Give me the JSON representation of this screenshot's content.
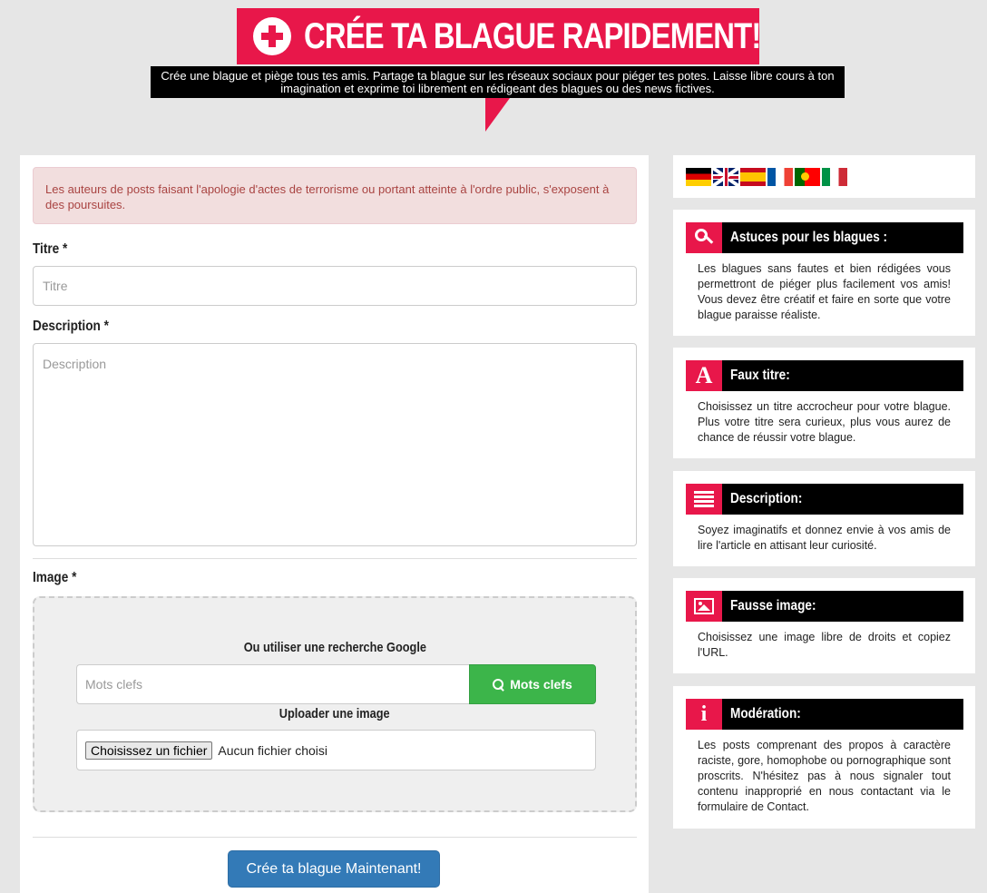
{
  "header": {
    "title": "CRÉE TA BLAGUE RAPIDEMENT!",
    "subtitle": "Crée une blague et piège tous tes amis. Partage ta blague sur les réseaux sociaux pour piéger tes potes. Laisse libre cours à ton imagination et exprime toi librement en rédigeant des blagues ou des news fictives.",
    "icon": "plus-circle-icon"
  },
  "form": {
    "alert": "Les auteurs de posts faisant l'apologie d'actes de terrorisme ou portant atteinte à l'ordre public, s'exposent à des poursuites.",
    "title_label": "Titre *",
    "title_placeholder": "Titre",
    "description_label": "Description *",
    "description_placeholder": "Description",
    "image_label": "Image *",
    "google_heading": "Ou utiliser une recherche Google",
    "keywords_placeholder": "Mots clefs",
    "keywords_button": "Mots clefs",
    "upload_heading": "Uploader une image",
    "file_button": "Choisissez un fichier",
    "file_status": "Aucun fichier choisi",
    "submit": "Crée ta blague Maintenant!"
  },
  "flags": [
    "de",
    "en",
    "es",
    "fr",
    "pt",
    "it"
  ],
  "tips": [
    {
      "icon": "key-icon",
      "title": "Astuces pour les blagues :",
      "text": "Les blagues sans fautes et bien rédigées vous permettront de piéger plus facilement vos amis! Vous devez être créatif et faire en sorte que votre blague paraisse réaliste."
    },
    {
      "icon": "font-icon",
      "title": "Faux titre:",
      "text": "Choisissez un titre accrocheur pour votre blague. Plus votre titre sera curieux, plus vous aurez de chance de réussir votre blague."
    },
    {
      "icon": "align-justify-icon",
      "title": "Description:",
      "text": "Soyez imaginatifs et donnez envie à vos amis de lire l'article en attisant leur curiosité."
    },
    {
      "icon": "picture-icon",
      "title": "Fausse image:",
      "text": "Choisissez une image libre de droits et copiez l'URL."
    },
    {
      "icon": "info-icon",
      "title": "Modération:",
      "text": "Les posts comprenant des propos à caractère raciste, gore, homophobe ou pornographique sont proscrits. N'hésitez pas à nous signaler tout contenu inapproprié en nous contactant via le formulaire de Contact."
    }
  ],
  "colors": {
    "accent": "#e8174a",
    "primary": "#337ab7",
    "success": "#3cb54a"
  }
}
